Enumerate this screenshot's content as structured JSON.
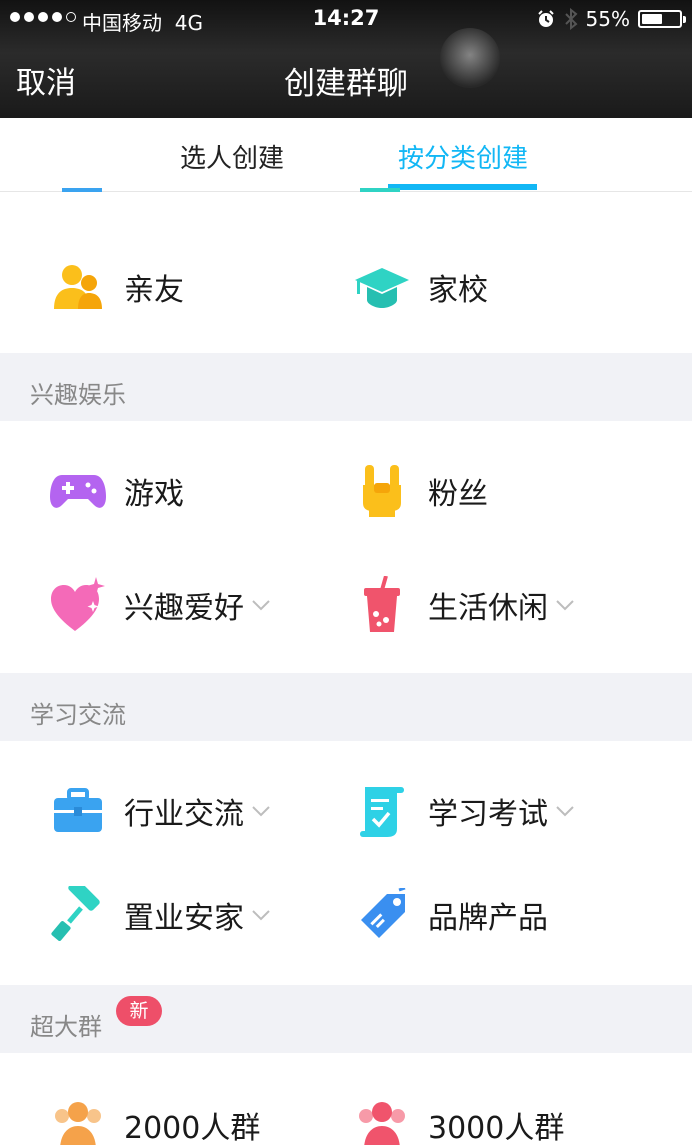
{
  "status_bar": {
    "carrier": "中国移动",
    "network": "4G",
    "time": "14:27",
    "battery": "55%",
    "battery_level": 0.55
  },
  "nav": {
    "cancel_label": "取消",
    "title": "创建群聊"
  },
  "tabs": [
    {
      "label": "选人创建",
      "selected": false
    },
    {
      "label": "按分类创建",
      "selected": true
    }
  ],
  "colors": {
    "accent": "#12b7f5",
    "section_bg": "#f1f2f6",
    "badge": "#ee4f69"
  },
  "top_items": [
    {
      "label": "亲友",
      "icon": "people-icon",
      "color": "#fbbf1b"
    },
    {
      "label": "家校",
      "icon": "graduation-cap-icon",
      "color": "#2fd3c4"
    }
  ],
  "sections": [
    {
      "title": "兴趣娱乐",
      "items": [
        {
          "label": "游戏",
          "icon": "gamepad-icon",
          "color": "#b464f0",
          "expandable": false
        },
        {
          "label": "粉丝",
          "icon": "rock-hand-icon",
          "color": "#fbbf1b",
          "expandable": false
        },
        {
          "label": "兴趣爱好",
          "icon": "heart-sparkle-icon",
          "color": "#f46ab8",
          "expandable": true
        },
        {
          "label": "生活休闲",
          "icon": "drink-cup-icon",
          "color": "#f0546c",
          "expandable": true
        }
      ]
    },
    {
      "title": "学习交流",
      "items": [
        {
          "label": "行业交流",
          "icon": "briefcase-icon",
          "color": "#3aa3f0",
          "expandable": true
        },
        {
          "label": "学习考试",
          "icon": "exam-scroll-icon",
          "color": "#2ed1e6",
          "expandable": true
        },
        {
          "label": "置业安家",
          "icon": "paint-roller-icon",
          "color": "#2fd3c4",
          "expandable": true
        },
        {
          "label": "品牌产品",
          "icon": "price-tag-icon",
          "color": "#3a8ff0",
          "expandable": false
        }
      ]
    },
    {
      "title": "超大群",
      "badge": "新",
      "items": [
        {
          "label": "2000人群",
          "icon": "people-group-icon",
          "color": "#f5a24a",
          "expandable": false
        },
        {
          "label": "3000人群",
          "icon": "people-group-icon",
          "color": "#f0546c",
          "expandable": false
        }
      ]
    }
  ]
}
